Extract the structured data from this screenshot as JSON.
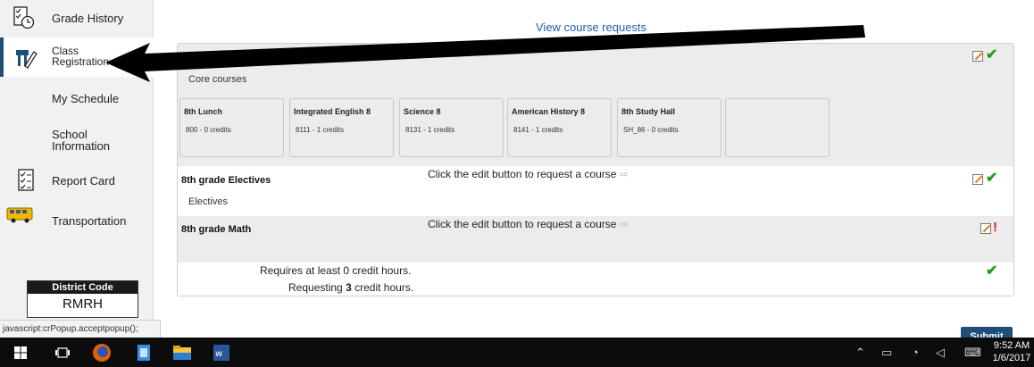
{
  "sidebar": {
    "items": [
      {
        "label": "Grade History",
        "icon": "grade-history-icon"
      },
      {
        "label": "Class Registration",
        "line1": "Class",
        "line2": "Registration",
        "icon": "class-registration-icon"
      },
      {
        "label": "My Schedule",
        "icon": ""
      },
      {
        "label": "School Information",
        "line1": "School",
        "line2": "Information",
        "icon": ""
      },
      {
        "label": "Report Card",
        "icon": "report-card-icon"
      },
      {
        "label": "Transportation",
        "icon": "school-bus-icon"
      }
    ],
    "district": {
      "label": "District Code",
      "value": "RMRH"
    }
  },
  "status_bar": {
    "text": "javascript:crPopup.acceptpopup();"
  },
  "main": {
    "view_requests_link": "View course requests",
    "core": {
      "title": "Core courses",
      "courses": [
        {
          "name": "8th Lunch",
          "credits": "800 - 0 credits"
        },
        {
          "name": "Integrated English 8",
          "credits": "8111 - 1 credits"
        },
        {
          "name": "Science 8",
          "credits": "8131 - 1 credits"
        },
        {
          "name": "American History 8",
          "credits": "8141 - 1 credits"
        },
        {
          "name": "8th Study Hall",
          "credits": "SH_86 - 0 credits"
        }
      ]
    },
    "electives": {
      "title": "8th grade Electives",
      "subtitle": "Electives",
      "hint": "Click the edit button to request a course"
    },
    "math": {
      "title": "8th grade Math",
      "hint": "Click the edit button to request a course"
    },
    "summary": {
      "requires": "Requires at least 0 credit hours.",
      "requesting_prefix": "Requesting",
      "requesting_count": "3",
      "requesting_suffix": "credit hours."
    },
    "submit_label": "Submit"
  },
  "taskbar": {
    "apps": [
      "windows-start-icon",
      "task-view-icon",
      "firefox-icon",
      "file-icon",
      "file-explorer-icon",
      "word-icon"
    ],
    "clock": {
      "time": "9:52 AM",
      "date": "1/6/2017"
    }
  },
  "colors": {
    "nav_accent": "#1f4e79",
    "link": "#1f5fa6",
    "ok": "#1aa31a",
    "error": "#d81e1e",
    "panel_gray": "#ececec"
  }
}
